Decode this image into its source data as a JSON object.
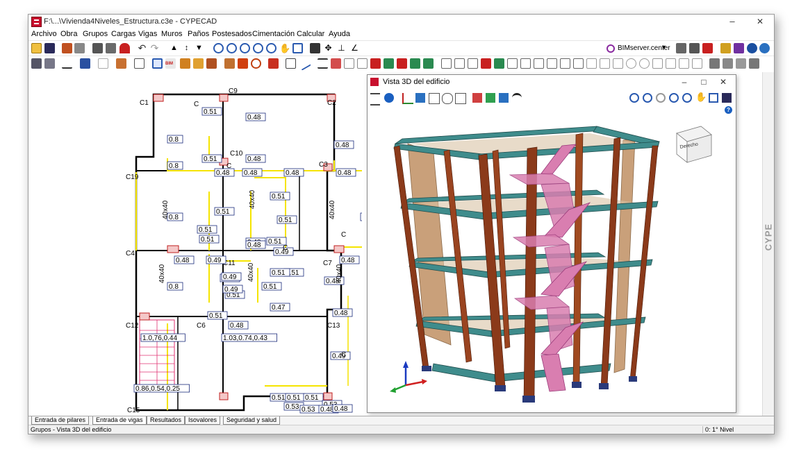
{
  "window": {
    "title": "F:\\...\\Vivienda4Niveles_Estructura.c3e - CYPECAD",
    "min": "–",
    "max": "❐",
    "close": "✕"
  },
  "menu": [
    "Archivo",
    "Obra",
    "Grupos",
    "Cargas",
    "Vigas",
    "Muros",
    "Paños",
    "Postesados",
    "Cimentación",
    "Calcular",
    "Ayuda"
  ],
  "toolbar": {
    "bimserver_label": "BIMserver.center",
    "bimserver_arrow": "▾",
    "bim_tag": "BIM"
  },
  "view3d": {
    "title": "Vista 3D del edificio",
    "min": "–",
    "max": "□",
    "close": "✕",
    "cube_label": "Derecho",
    "help": "?"
  },
  "plan": {
    "columns": [
      "C1",
      "C9",
      "C2",
      "C10",
      "C3",
      "C19",
      "C4",
      "C11",
      "C7",
      "C12",
      "C6",
      "C13",
      "C15",
      "C7"
    ],
    "dimensions": [
      "0.51",
      "0.48",
      "0.8",
      "0.48",
      "0.51",
      "0.48",
      "0.8",
      "0.48",
      "0.48",
      "0.48",
      "0.48",
      "0.51",
      "0.51",
      "0.51",
      "0.8",
      "0.51",
      "0.51",
      "0.48",
      "0.51",
      "0.51",
      "0.48",
      "0.49",
      "0.49",
      "0.51",
      "0.48",
      "0.51",
      "0.48",
      "0.51",
      "0.8",
      "0.51",
      "0.49",
      "0.48",
      "0.51",
      "0.49",
      "0.47",
      "0.48",
      "0.48",
      "0.49",
      "0.51",
      "0.51",
      "0.51",
      "0.51",
      "0.53",
      "0.53",
      "0.53",
      "0.48",
      "0.48"
    ],
    "column_sizes": [
      "40x40",
      "40x40",
      "40x40",
      "40x40",
      "40x40",
      "40x40"
    ],
    "combos": [
      "1.0,76,0.44",
      "1.03,0.74,0.43",
      "0.86,0.54,0.25"
    ],
    "side_c": "C"
  },
  "sidebar": {
    "label": "CYPE"
  },
  "tabs": [
    "Entrada de pilares",
    "Entrada de vigas",
    "Resultados",
    "Isovalores",
    "Seguridad y salud"
  ],
  "status": {
    "left": "Grupos - Vista 3D del edificio",
    "right": "0: 1° Nivel"
  },
  "colors": {
    "slab_teal": "#3f8c8c",
    "column_brown": "#8b3a1a",
    "wall_tan": "#c9a07a",
    "stair_pink": "#d97eb0",
    "plan_yellow": "#f5e400",
    "plan_pink": "#e03070"
  }
}
